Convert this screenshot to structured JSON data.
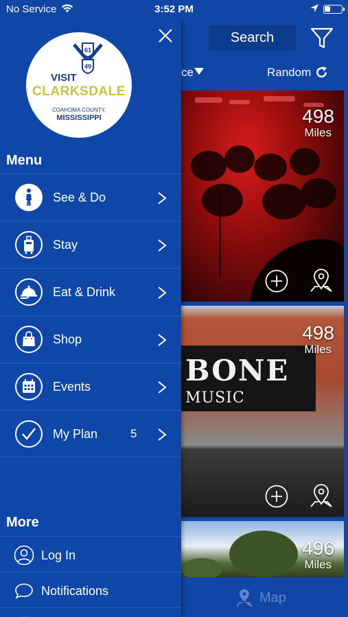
{
  "status_bar": {
    "carrier": "No Service",
    "time": "3:52 PM"
  },
  "header": {
    "search_label": "Search",
    "sort_label": "ce",
    "random_label": "Random"
  },
  "cards": [
    {
      "miles_value": "498",
      "miles_unit": "Miles"
    },
    {
      "miles_value": "498",
      "miles_unit": "Miles",
      "mural_line1": "BONE",
      "mural_line2": "MUSIC"
    },
    {
      "miles_value": "496",
      "miles_unit": "Miles"
    }
  ],
  "bottom_bar": {
    "map_label": "Map"
  },
  "drawer": {
    "logo": {
      "line1": "VISIT",
      "line2": "CLARKSDALE",
      "line3": "COAHOMA COUNTY,",
      "line4": "MISSISSIPPI",
      "sign_top": "61",
      "sign_bottom": "49"
    },
    "menu_title": "Menu",
    "menu_items": [
      {
        "label": "See & Do",
        "icon": "walking-person-icon"
      },
      {
        "label": "Stay",
        "icon": "luggage-icon"
      },
      {
        "label": "Eat & Drink",
        "icon": "cloche-icon"
      },
      {
        "label": "Shop",
        "icon": "shopping-bag-icon"
      },
      {
        "label": "Events",
        "icon": "calendar-icon"
      },
      {
        "label": "My Plan",
        "icon": "checkmark-icon",
        "badge": "5"
      }
    ],
    "more_title": "More",
    "more_items": [
      {
        "label": "Log In",
        "icon": "user-icon"
      },
      {
        "label": "Notifications",
        "icon": "chat-bubble-icon"
      }
    ]
  },
  "colors": {
    "primary": "#1046a6",
    "drawer": "#0f47a8",
    "divider": "#2a5cb6",
    "logo_yellow": "#c9c437"
  }
}
